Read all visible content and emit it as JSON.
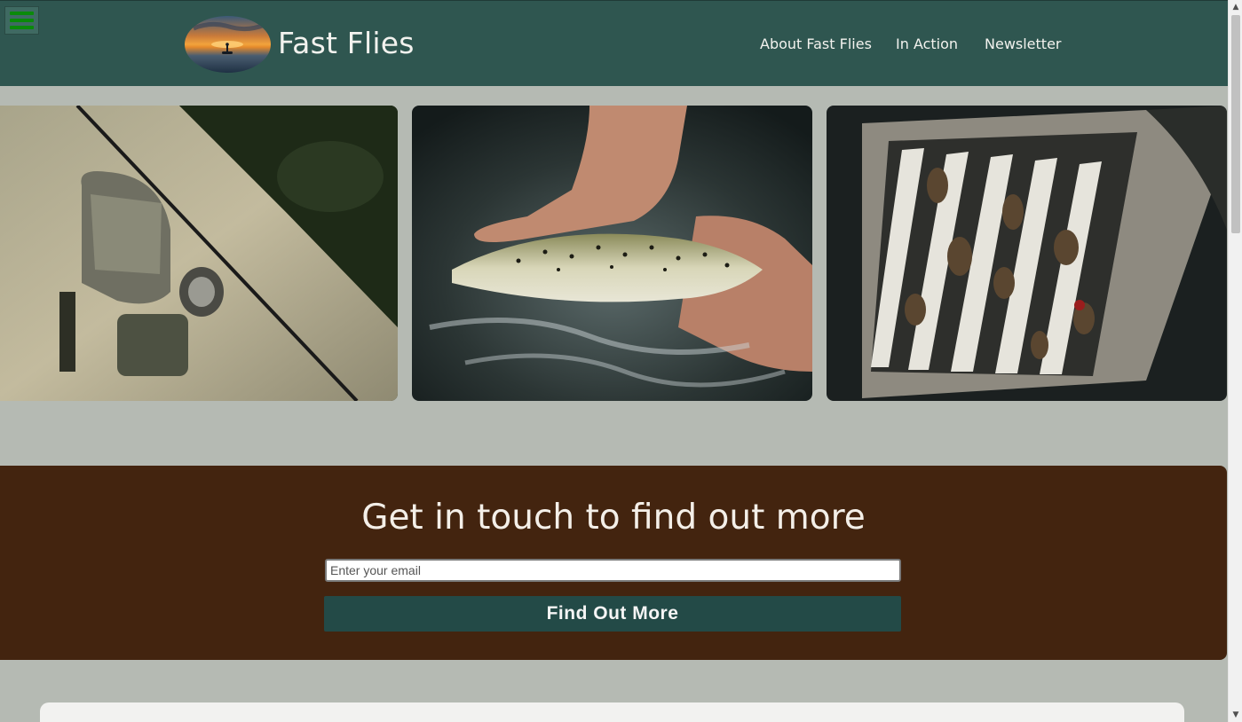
{
  "header": {
    "brand": "Fast Flies",
    "menu_icon": "hamburger-menu-icon",
    "logo_image": "sunset-kayak-logo",
    "nav": [
      {
        "label": "About Fast Flies"
      },
      {
        "label": "In Action"
      },
      {
        "label": "Newsletter"
      }
    ]
  },
  "gallery": [
    {
      "image": "fishing-rod-backpack-on-rock"
    },
    {
      "image": "hand-holding-trout-in-water"
    },
    {
      "image": "fly-box-with-flies"
    }
  ],
  "contact": {
    "heading": "Get in touch to find out more",
    "email_placeholder": "Enter your email",
    "button_label": "Find Out More"
  },
  "colors": {
    "header_bg": "#2f5650",
    "page_bg": "#b5bab3",
    "contact_bg": "#43240f",
    "button_bg": "#234a47",
    "menu_icon": "#0a8a0a"
  }
}
